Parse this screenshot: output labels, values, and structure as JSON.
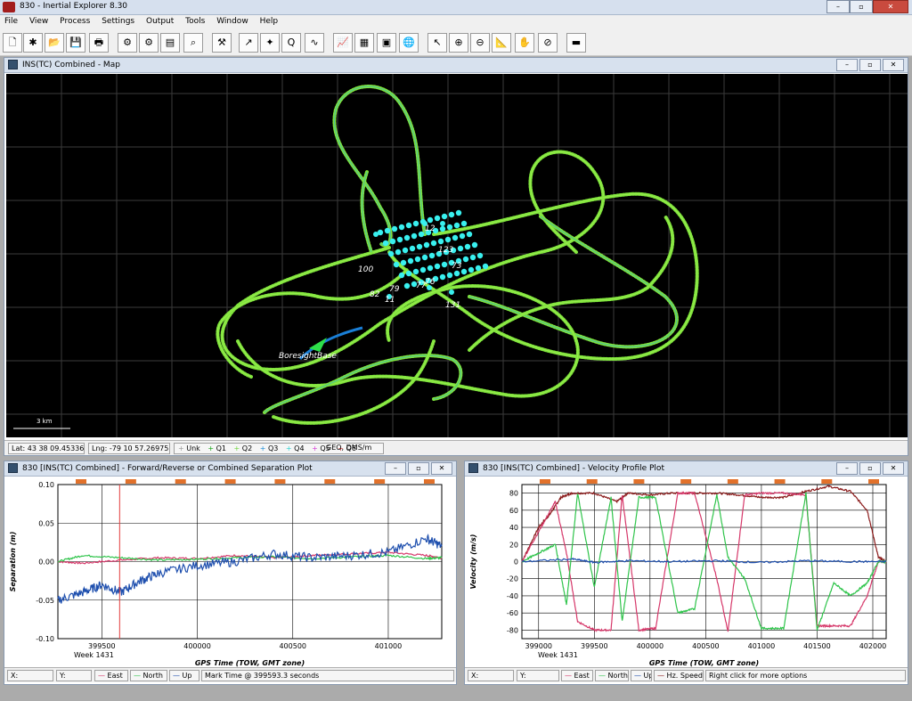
{
  "app": {
    "title": "830 - Inertial Explorer 8.30"
  },
  "window_buttons": [
    "–",
    "▫",
    "✕"
  ],
  "menu": [
    "File",
    "View",
    "Process",
    "Settings",
    "Output",
    "Tools",
    "Window",
    "Help"
  ],
  "map": {
    "title": "INS(TC) Combined - Map",
    "base_label": "BoresightBase",
    "scale_label": "3 km",
    "cluster_labels": [
      "12",
      "123",
      "131",
      "11",
      "100",
      "73",
      "77",
      "76",
      "82",
      "79"
    ],
    "status": {
      "lat": "Lat: 43 38 09.45336",
      "lng": "Lng: -79 10 57.26975",
      "quality": [
        "Unk",
        "Q1",
        "Q2",
        "Q3",
        "Q4",
        "Q5",
        "Q6"
      ],
      "coords": "GEO, DMS/m"
    }
  },
  "sep_plot": {
    "title": "830 [INS(TC) Combined] - Forward/Reverse or Combined Separation Plot",
    "status": {
      "x": "X:",
      "y": "Y:",
      "legend": [
        "East",
        "North",
        "Up"
      ],
      "mark": "Mark Time @ 399593.3 seconds"
    }
  },
  "vel_plot": {
    "title": "830 [INS(TC) Combined] - Velocity Profile Plot",
    "status": {
      "x": "X:",
      "y": "Y:",
      "legend": [
        "East",
        "North",
        "Up",
        "Hz. Speed"
      ],
      "hint": "Right click for more options"
    }
  },
  "colors": {
    "east": "#d6386a",
    "north": "#2ec44a",
    "up": "#1e4fae",
    "speed": "#8a1a1a",
    "track": "#7fe43c",
    "cluster": "#39f0ef"
  },
  "chart_data": [
    {
      "type": "line",
      "title": "",
      "xlabel": "GPS Time (TOW, GMT zone)",
      "ylabel": "Separation (m)",
      "x_ticks": [
        "399500",
        "400000",
        "400500",
        "401000"
      ],
      "x_sub": "Week 1431",
      "y_ticks": [
        "0.10",
        "0.05",
        "0.00",
        "-0.05",
        "-0.10"
      ],
      "xlim": [
        399270,
        401280
      ],
      "ylim": [
        -0.1,
        0.1
      ],
      "mark_time": 399593.3,
      "series": [
        {
          "name": "East",
          "x": [
            399270,
            399400,
            399600,
            399800,
            400000,
            400200,
            400400,
            400600,
            400800,
            401000,
            401200,
            401280
          ],
          "y": [
            0.0,
            -0.002,
            0.002,
            0.005,
            0.004,
            0.008,
            0.005,
            0.008,
            0.01,
            0.012,
            0.008,
            0.005
          ]
        },
        {
          "name": "North",
          "x": [
            399270,
            399400,
            399600,
            399800,
            400000,
            400200,
            400400,
            400600,
            400800,
            401000,
            401200,
            401280
          ],
          "y": [
            0.0,
            0.008,
            0.005,
            0.002,
            0.003,
            0.005,
            0.006,
            0.004,
            0.006,
            0.008,
            0.004,
            0.005
          ]
        },
        {
          "name": "Up",
          "x": [
            399270,
            399400,
            399500,
            399600,
            399700,
            399800,
            400000,
            400200,
            400400,
            400600,
            400800,
            401000,
            401200,
            401280
          ],
          "y": [
            -0.05,
            -0.04,
            -0.03,
            -0.04,
            -0.025,
            -0.015,
            -0.005,
            0.0,
            0.01,
            0.005,
            0.008,
            0.012,
            0.03,
            0.02
          ]
        }
      ]
    },
    {
      "type": "line",
      "title": "",
      "xlabel": "GPS Time (TOW, GMT zone)",
      "ylabel": "Velocity (m/s)",
      "x_ticks": [
        "399000",
        "399500",
        "400000",
        "400500",
        "401000",
        "401500",
        "402000"
      ],
      "x_sub": "Week 1431",
      "y_ticks": [
        "80",
        "60",
        "40",
        "20",
        "0",
        "-20",
        "-40",
        "-60",
        "-80"
      ],
      "xlim": [
        398850,
        402120
      ],
      "ylim": [
        -90,
        90
      ],
      "series": [
        {
          "name": "Hz. Speed",
          "x": [
            398850,
            399000,
            399100,
            399200,
            399300,
            399500,
            399700,
            399800,
            400000,
            400200,
            400400,
            400600,
            400800,
            401000,
            401200,
            401400,
            401600,
            401800,
            401950,
            402050,
            402120
          ],
          "y": [
            0,
            40,
            55,
            75,
            80,
            80,
            70,
            80,
            78,
            80,
            80,
            80,
            78,
            75,
            75,
            82,
            88,
            82,
            60,
            5,
            0
          ]
        },
        {
          "name": "East",
          "x": [
            398850,
            399000,
            399150,
            399250,
            399350,
            399500,
            399650,
            399750,
            399900,
            400050,
            400250,
            400400,
            400600,
            400700,
            400850,
            401000,
            401200,
            401400,
            401500,
            401650,
            401800,
            401950,
            402050,
            402120
          ],
          "y": [
            0,
            35,
            70,
            10,
            -70,
            -80,
            -80,
            78,
            -80,
            -78,
            80,
            80,
            -20,
            -82,
            78,
            80,
            80,
            78,
            -75,
            -75,
            -75,
            -40,
            0,
            0
          ]
        },
        {
          "name": "North",
          "x": [
            398850,
            399000,
            399150,
            399250,
            399350,
            399500,
            399650,
            399750,
            399900,
            400050,
            400250,
            400400,
            400600,
            400700,
            400850,
            401000,
            401200,
            401400,
            401500,
            401650,
            401800,
            401950,
            402050,
            402120
          ],
          "y": [
            0,
            10,
            20,
            -50,
            80,
            -30,
            75,
            -70,
            75,
            75,
            -60,
            -55,
            78,
            5,
            -20,
            -78,
            -78,
            80,
            -80,
            -25,
            -40,
            -25,
            0,
            0
          ]
        },
        {
          "name": "Up",
          "x": [
            398850,
            399300,
            399500,
            399800,
            400200,
            400600,
            401000,
            401400,
            401800,
            402120
          ],
          "y": [
            0,
            3,
            -1,
            1,
            0,
            1,
            -1,
            1,
            0,
            0
          ]
        }
      ]
    }
  ]
}
